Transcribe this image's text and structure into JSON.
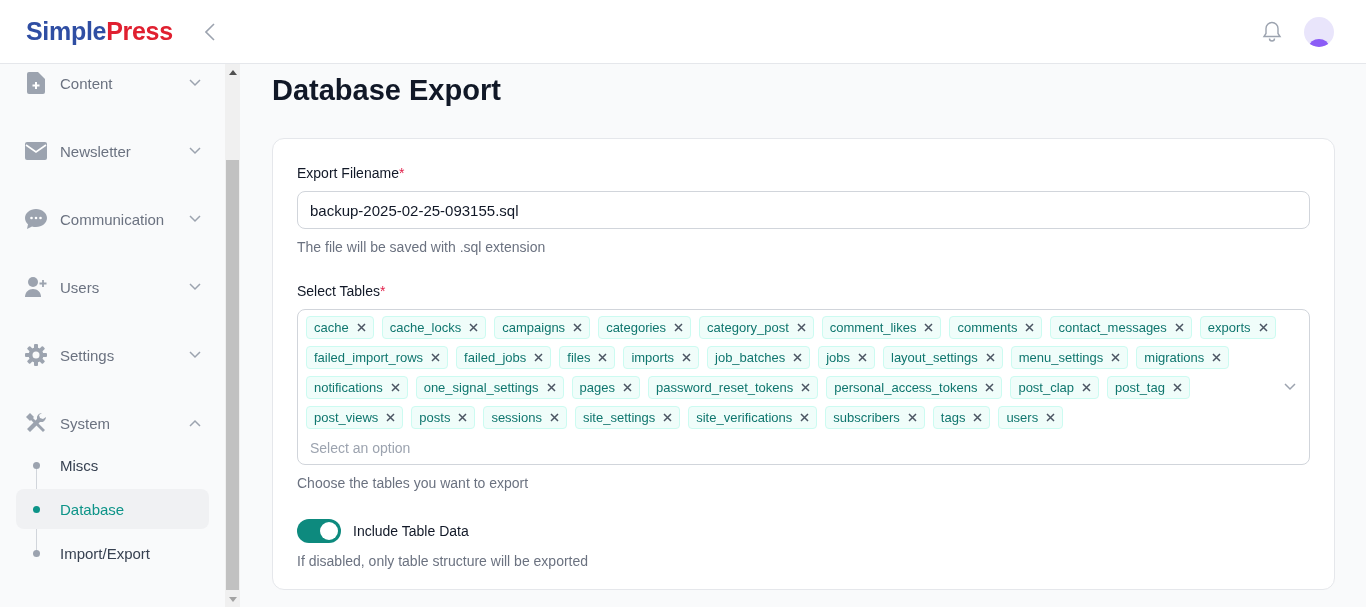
{
  "logo": {
    "part_1": "Simple",
    "part_2": "Press"
  },
  "sidebar": {
    "items": [
      {
        "label": "Content",
        "expanded": false
      },
      {
        "label": "Newsletter",
        "expanded": false
      },
      {
        "label": "Communication",
        "expanded": false
      },
      {
        "label": "Users",
        "expanded": false
      },
      {
        "label": "Settings",
        "expanded": false
      },
      {
        "label": "System",
        "expanded": true,
        "children": [
          {
            "label": "Miscs",
            "selected": false
          },
          {
            "label": "Database",
            "selected": true
          },
          {
            "label": "Import/Export",
            "selected": false
          }
        ]
      }
    ]
  },
  "page_title": "Database Export",
  "form": {
    "filename": {
      "label": "Export Filename",
      "required_mark": "*",
      "value": "backup-2025-02-25-093155.sql",
      "help": "The file will be saved with .sql extension"
    },
    "tables": {
      "label": "Select Tables",
      "required_mark": "*",
      "expanded": false,
      "placeholder": "Select an option",
      "help": "Choose the tables you want to export",
      "selected": [
        "cache",
        "cache_locks",
        "campaigns",
        "categories",
        "category_post",
        "comment_likes",
        "comments",
        "contact_messages",
        "exports",
        "failed_import_rows",
        "failed_jobs",
        "files",
        "imports",
        "job_batches",
        "jobs",
        "layout_settings",
        "menu_settings",
        "migrations",
        "notifications",
        "one_signal_settings",
        "pages",
        "password_reset_tokens",
        "personal_access_tokens",
        "post_clap",
        "post_tag",
        "post_views",
        "posts",
        "sessions",
        "site_settings",
        "site_verifications",
        "subscribers",
        "tags",
        "users"
      ]
    },
    "include_data": {
      "label": "Include Table Data",
      "on": true,
      "help": "If disabled, only table structure will be exported"
    }
  }
}
